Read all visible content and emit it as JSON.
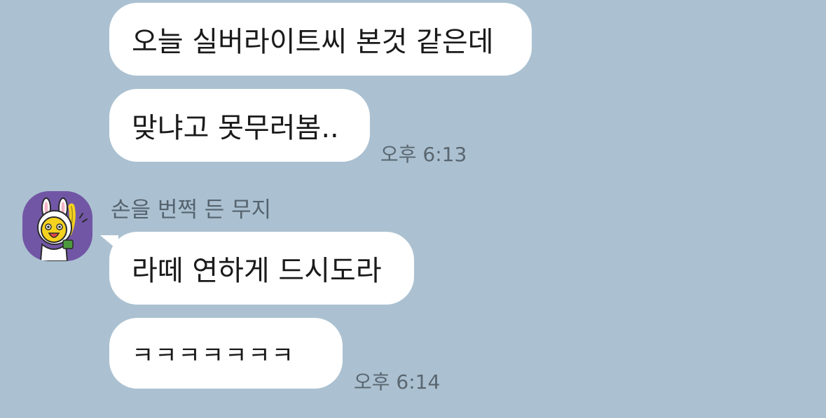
{
  "chat": {
    "background_color": "#abc1d1",
    "messages": [
      {
        "text": "오늘 실버라이트씨 본것 같은데"
      },
      {
        "text": "맞냐고 못무러봄..",
        "time": "오후 6:13"
      },
      {
        "text": "라떼 연하게 드시도라"
      },
      {
        "text": "ㅋㅋㅋㅋㅋㅋㅋ",
        "time": "오후 6:14"
      }
    ],
    "sender": {
      "name": "손을 번쩍 든 무지",
      "avatar_icon": "muzi-rabbit-character-icon",
      "avatar_color": "#7256a6"
    }
  }
}
